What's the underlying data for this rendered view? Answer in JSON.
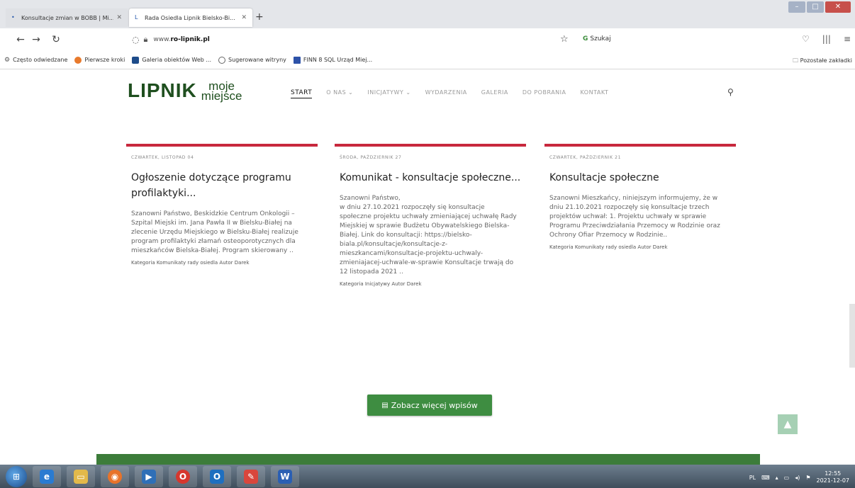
{
  "browser": {
    "tabs": [
      {
        "label": "Konsultacje zmian w BOBB | Mi...",
        "active": false
      },
      {
        "label": "Rada Osiedla Lipnik Bielsko-Bi...",
        "active": true
      }
    ],
    "url_prefix": "www.",
    "url_domain": "ro-lipnik.pl",
    "search_label": "Szukaj",
    "bookmarks": [
      "Często odwiedzane",
      "Pierwsze kroki",
      "Galeria obiektów Web ...",
      "Sugerowane witryny",
      "FINN 8 SQL Urząd Miej..."
    ],
    "other_bookmarks": "Pozostałe zakładki"
  },
  "site": {
    "logo_main": "LIPNIK",
    "logo_sub_1": "moje",
    "logo_sub_2": "miejsce",
    "menu": [
      {
        "label": "START",
        "active": true
      },
      {
        "label": "O NAS ⌄",
        "active": false
      },
      {
        "label": "INICJATYWY ⌄",
        "active": false
      },
      {
        "label": "WYDARZENIA",
        "active": false
      },
      {
        "label": "GALERIA",
        "active": false
      },
      {
        "label": "DO POBRANIA",
        "active": false
      },
      {
        "label": "KONTAKT",
        "active": false
      }
    ],
    "posts": [
      {
        "date": "CZWARTEK, LISTOPAD 04",
        "title": "Ogłoszenie dotyczące programu profilaktyki...",
        "body": "Szanowni Państwo, Beskidzkie Centrum Onkologii – Szpital Miejski im. Jana Pawła II w Bielsku-Białej na zlecenie Urzędu Miejskiego w Bielsku-Białej realizuje program profilaktyki złamań osteoporotycznych dla mieszkańców Bielska-Białej. Program skierowany ..",
        "meta": "Kategoria Komunikaty rady osiedla Autor Darek"
      },
      {
        "date": "ŚRODA, PAŹDZIERNIK 27",
        "title": "Komunikat - konsultacje społeczne...",
        "body": "Szanowni Państwo,\nw dniu 27.10.2021 rozpoczęły się konsultacje społeczne projektu uchwały zmieniającej uchwałę Rady Miejskiej w sprawie Budżetu Obywatelskiego Bielska-Białej. Link do konsultacji: https://bielsko-biala.pl/konsultacje/konsultacje-z-mieszkancami/konsultacje-projektu-uchwaly-zmieniajacej-uchwale-w-sprawie Konsultacje trwają do 12 listopada 2021 ..",
        "meta": "Kategoria Inicjatywy Autor Darek"
      },
      {
        "date": "CZWARTEK, PAŹDZIERNIK 21",
        "title": "Konsultacje społeczne",
        "body": "Szanowni Mieszkańcy, niniejszym informujemy, że w dniu 21.10.2021 rozpoczęły się konsultacje trzech projektów uchwał: 1. Projektu uchwały w sprawie Programu Przeciwdziałania Przemocy w Rodzinie oraz Ochrony Ofiar Przemocy w Rodzinie..",
        "meta": "Kategoria Komunikaty rady osiedla Autor Darek"
      }
    ],
    "more_button": "Zobacz więcej wpisów"
  },
  "taskbar": {
    "lang": "PL",
    "time": "12:55",
    "date": "2021-12-07"
  },
  "colors": {
    "accent_red": "#c8283d",
    "brand_green": "#3e8d41",
    "logo_green": "#1f4f1f"
  }
}
